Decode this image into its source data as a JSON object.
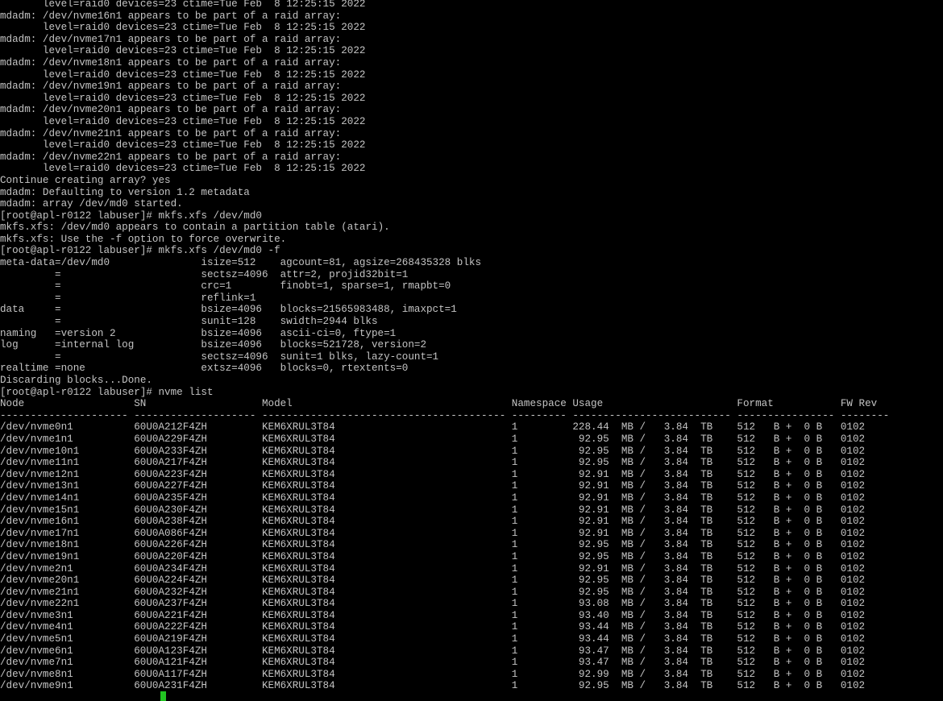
{
  "terminal": {
    "prompt": "[root@apl-r0122 labuser]#",
    "preamble": [
      "       level=raid0 devices=23 ctime=Tue Feb  8 12:25:15 2022",
      "mdadm: /dev/nvme16n1 appears to be part of a raid array:",
      "       level=raid0 devices=23 ctime=Tue Feb  8 12:25:15 2022",
      "mdadm: /dev/nvme17n1 appears to be part of a raid array:",
      "       level=raid0 devices=23 ctime=Tue Feb  8 12:25:15 2022",
      "mdadm: /dev/nvme18n1 appears to be part of a raid array:",
      "       level=raid0 devices=23 ctime=Tue Feb  8 12:25:15 2022",
      "mdadm: /dev/nvme19n1 appears to be part of a raid array:",
      "       level=raid0 devices=23 ctime=Tue Feb  8 12:25:15 2022",
      "mdadm: /dev/nvme20n1 appears to be part of a raid array:",
      "       level=raid0 devices=23 ctime=Tue Feb  8 12:25:15 2022",
      "mdadm: /dev/nvme21n1 appears to be part of a raid array:",
      "       level=raid0 devices=23 ctime=Tue Feb  8 12:25:15 2022",
      "mdadm: /dev/nvme22n1 appears to be part of a raid array:",
      "       level=raid0 devices=23 ctime=Tue Feb  8 12:25:15 2022",
      "Continue creating array? yes",
      "mdadm: Defaulting to version 1.2 metadata",
      "mdadm: array /dev/md0 started.",
      "[root@apl-r0122 labuser]# mkfs.xfs /dev/md0",
      "mkfs.xfs: /dev/md0 appears to contain a partition table (atari).",
      "mkfs.xfs: Use the -f option to force overwrite.",
      "[root@apl-r0122 labuser]# mkfs.xfs /dev/md0 -f"
    ],
    "mkfs_output": [
      [
        "meta-data=/dev/md0",
        "isize=512",
        "agcount=81, agsize=268435328 blks"
      ],
      [
        "         =",
        "sectsz=4096",
        "attr=2, projid32bit=1"
      ],
      [
        "         =",
        "crc=1",
        "finobt=1, sparse=1, rmapbt=0"
      ],
      [
        "         =",
        "reflink=1",
        ""
      ],
      [
        "data     =",
        "bsize=4096",
        "blocks=21565983488, imaxpct=1"
      ],
      [
        "         =",
        "sunit=128",
        "swidth=2944 blks"
      ],
      [
        "naming   =version 2",
        "bsize=4096",
        "ascii-ci=0, ftype=1"
      ],
      [
        "log      =internal log",
        "bsize=4096",
        "blocks=521728, version=2"
      ],
      [
        "         =",
        "sectsz=4096",
        "sunit=1 blks, lazy-count=1"
      ],
      [
        "realtime =none",
        "extsz=4096",
        "blocks=0, rtextents=0"
      ]
    ],
    "after_mkfs": [
      "Discarding blocks...Done.",
      "[root@apl-r0122 labuser]# nvme list"
    ],
    "nvme_table": {
      "headers": [
        "Node",
        "SN",
        "Model",
        "Namespace",
        "Usage",
        "Format",
        "FW Rev"
      ],
      "separators": [
        "---------------------",
        "--------------------",
        "----------------------------------------",
        "---------",
        "--------------------------",
        "----------------",
        "--------"
      ],
      "rows": [
        [
          "/dev/nvme0n1",
          "60U0A212F4ZH",
          "KEM6XRUL3T84",
          "1",
          "228.44  MB /   3.84  TB",
          "512   B +  0 B",
          "0102"
        ],
        [
          "/dev/nvme1n1",
          "60U0A229F4ZH",
          "KEM6XRUL3T84",
          "1",
          " 92.95  MB /   3.84  TB",
          "512   B +  0 B",
          "0102"
        ],
        [
          "/dev/nvme10n1",
          "60U0A233F4ZH",
          "KEM6XRUL3T84",
          "1",
          " 92.95  MB /   3.84  TB",
          "512   B +  0 B",
          "0102"
        ],
        [
          "/dev/nvme11n1",
          "60U0A217F4ZH",
          "KEM6XRUL3T84",
          "1",
          " 92.95  MB /   3.84  TB",
          "512   B +  0 B",
          "0102"
        ],
        [
          "/dev/nvme12n1",
          "60U0A223F4ZH",
          "KEM6XRUL3T84",
          "1",
          " 92.91  MB /   3.84  TB",
          "512   B +  0 B",
          "0102"
        ],
        [
          "/dev/nvme13n1",
          "60U0A227F4ZH",
          "KEM6XRUL3T84",
          "1",
          " 92.91  MB /   3.84  TB",
          "512   B +  0 B",
          "0102"
        ],
        [
          "/dev/nvme14n1",
          "60U0A235F4ZH",
          "KEM6XRUL3T84",
          "1",
          " 92.91  MB /   3.84  TB",
          "512   B +  0 B",
          "0102"
        ],
        [
          "/dev/nvme15n1",
          "60U0A230F4ZH",
          "KEM6XRUL3T84",
          "1",
          " 92.91  MB /   3.84  TB",
          "512   B +  0 B",
          "0102"
        ],
        [
          "/dev/nvme16n1",
          "60U0A238F4ZH",
          "KEM6XRUL3T84",
          "1",
          " 92.91  MB /   3.84  TB",
          "512   B +  0 B",
          "0102"
        ],
        [
          "/dev/nvme17n1",
          "60U0A086F4ZH",
          "KEM6XRUL3T84",
          "1",
          " 92.91  MB /   3.84  TB",
          "512   B +  0 B",
          "0102"
        ],
        [
          "/dev/nvme18n1",
          "60U0A226F4ZH",
          "KEM6XRUL3T84",
          "1",
          " 92.95  MB /   3.84  TB",
          "512   B +  0 B",
          "0102"
        ],
        [
          "/dev/nvme19n1",
          "60U0A220F4ZH",
          "KEM6XRUL3T84",
          "1",
          " 92.95  MB /   3.84  TB",
          "512   B +  0 B",
          "0102"
        ],
        [
          "/dev/nvme2n1",
          "60U0A234F4ZH",
          "KEM6XRUL3T84",
          "1",
          " 92.91  MB /   3.84  TB",
          "512   B +  0 B",
          "0102"
        ],
        [
          "/dev/nvme20n1",
          "60U0A224F4ZH",
          "KEM6XRUL3T84",
          "1",
          " 92.95  MB /   3.84  TB",
          "512   B +  0 B",
          "0102"
        ],
        [
          "/dev/nvme21n1",
          "60U0A232F4ZH",
          "KEM6XRUL3T84",
          "1",
          " 92.95  MB /   3.84  TB",
          "512   B +  0 B",
          "0102"
        ],
        [
          "/dev/nvme22n1",
          "60U0A237F4ZH",
          "KEM6XRUL3T84",
          "1",
          " 93.08  MB /   3.84  TB",
          "512   B +  0 B",
          "0102"
        ],
        [
          "/dev/nvme3n1",
          "60U0A221F4ZH",
          "KEM6XRUL3T84",
          "1",
          " 93.40  MB /   3.84  TB",
          "512   B +  0 B",
          "0102"
        ],
        [
          "/dev/nvme4n1",
          "60U0A222F4ZH",
          "KEM6XRUL3T84",
          "1",
          " 93.44  MB /   3.84  TB",
          "512   B +  0 B",
          "0102"
        ],
        [
          "/dev/nvme5n1",
          "60U0A219F4ZH",
          "KEM6XRUL3T84",
          "1",
          " 93.44  MB /   3.84  TB",
          "512   B +  0 B",
          "0102"
        ],
        [
          "/dev/nvme6n1",
          "60U0A123F4ZH",
          "KEM6XRUL3T84",
          "1",
          " 93.47  MB /   3.84  TB",
          "512   B +  0 B",
          "0102"
        ],
        [
          "/dev/nvme7n1",
          "60U0A121F4ZH",
          "KEM6XRUL3T84",
          "1",
          " 93.47  MB /   3.84  TB",
          "512   B +  0 B",
          "0102"
        ],
        [
          "/dev/nvme8n1",
          "60U0A117F4ZH",
          "KEM6XRUL3T84",
          "1",
          " 92.99  MB /   3.84  TB",
          "512   B +  0 B",
          "0102"
        ],
        [
          "/dev/nvme9n1",
          "60U0A231F4ZH",
          "KEM6XRUL3T84",
          "1",
          " 92.95  MB /   3.84  TB",
          "512   B +  0 B",
          "0102"
        ]
      ]
    },
    "colors": {
      "background": "#000000",
      "text": "#c4c4c4",
      "cursor": "#22c422"
    }
  }
}
